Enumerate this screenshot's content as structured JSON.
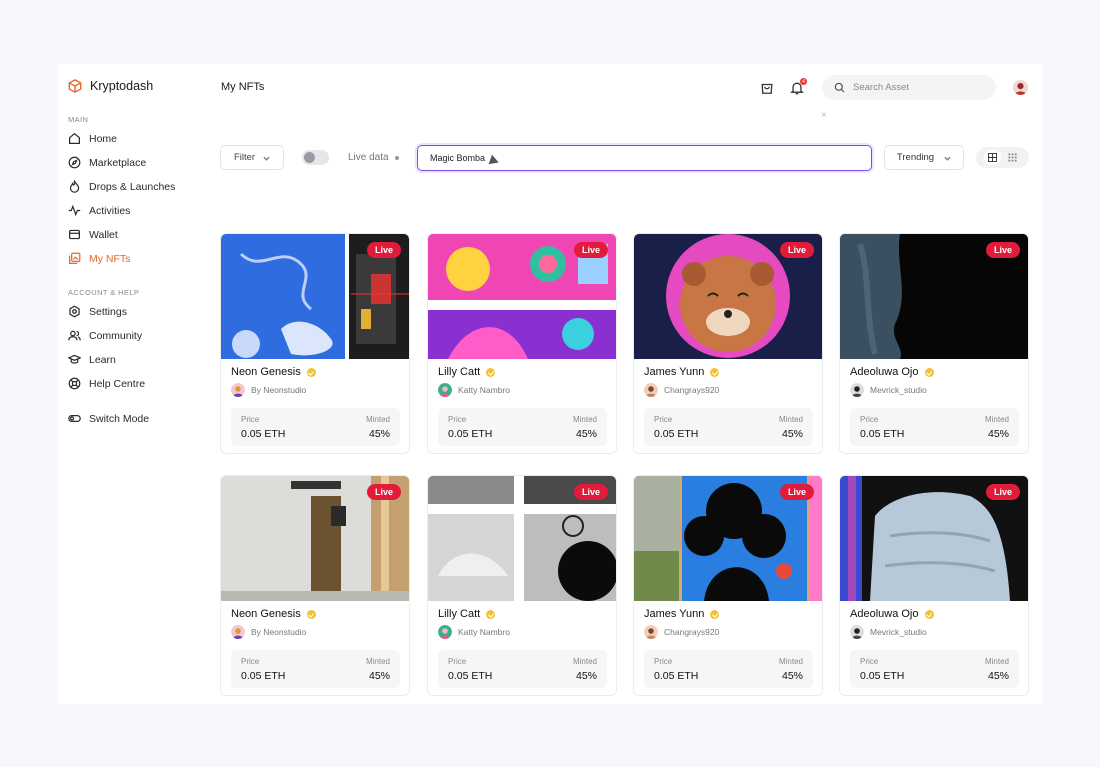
{
  "brand": {
    "name": "Kryptodash",
    "accent": "#e8672a"
  },
  "sidebar": {
    "main_label": "MAIN",
    "items": [
      {
        "label": "Home",
        "icon": "home-icon"
      },
      {
        "label": "Marketplace",
        "icon": "compass-icon"
      },
      {
        "label": "Drops & Launches",
        "icon": "flame-icon"
      },
      {
        "label": "Activities",
        "icon": "activity-icon"
      },
      {
        "label": "Wallet",
        "icon": "wallet-icon"
      },
      {
        "label": "My NFTs",
        "icon": "nft-icon",
        "active": true
      }
    ],
    "account_label": "ACCOUNT & HELP",
    "account_items": [
      {
        "label": "Settings",
        "icon": "gear-icon"
      },
      {
        "label": "Community",
        "icon": "users-icon"
      },
      {
        "label": "Learn",
        "icon": "graduation-cap-icon"
      },
      {
        "label": "Help Centre",
        "icon": "lifebuoy-icon"
      }
    ],
    "switch_mode": {
      "label": "Switch Mode",
      "icon": "toggle-icon"
    }
  },
  "header": {
    "title": "My NFTs",
    "notification_count": "4",
    "search_placeholder": "Search Asset"
  },
  "toolbar": {
    "filter_label": "Filter",
    "live_data_label": "Live data",
    "search_value": "Magic Bomba",
    "sort_label": "Trending"
  },
  "cards": [
    {
      "title": "Neon Genesis",
      "creator": "By Neonstudio",
      "badge": "Live",
      "price_label": "Price",
      "price": "0.05 ETH",
      "minted_label": "Minted",
      "minted": "45%"
    },
    {
      "title": "Lilly Catt",
      "creator": "Katty Nambro",
      "badge": "Live",
      "price_label": "Price",
      "price": "0.05 ETH",
      "minted_label": "Minted",
      "minted": "45%"
    },
    {
      "title": "James Yunn",
      "creator": "Changrays920",
      "badge": "Live",
      "price_label": "Price",
      "price": "0.05 ETH",
      "minted_label": "Minted",
      "minted": "45%"
    },
    {
      "title": "Adeoluwa Ojo",
      "creator": "Mevrick_studio",
      "badge": "Live",
      "price_label": "Price",
      "price": "0.05 ETH",
      "minted_label": "Minted",
      "minted": "45%"
    },
    {
      "title": "Neon Genesis",
      "creator": "By Neonstudio",
      "badge": "Live",
      "price_label": "Price",
      "price": "0.05 ETH",
      "minted_label": "Minted",
      "minted": "45%"
    },
    {
      "title": "Lilly Catt",
      "creator": "Katty Nambro",
      "badge": "Live",
      "price_label": "Price",
      "price": "0.05 ETH",
      "minted_label": "Minted",
      "minted": "45%"
    },
    {
      "title": "James Yunn",
      "creator": "Changrays920",
      "badge": "Live",
      "price_label": "Price",
      "price": "0.05 ETH",
      "minted_label": "Minted",
      "minted": "45%"
    },
    {
      "title": "Adeoluwa Ojo",
      "creator": "Mevrick_studio",
      "badge": "Live",
      "price_label": "Price",
      "price": "0.05 ETH",
      "minted_label": "Minted",
      "minted": "45%"
    }
  ]
}
